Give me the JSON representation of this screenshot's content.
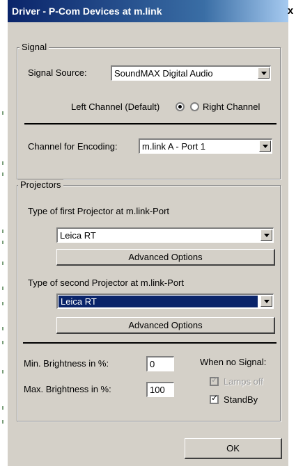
{
  "window": {
    "title": "Driver - P-Com Devices at m.link"
  },
  "signal": {
    "group_label": "Signal",
    "source_label": "Signal Source:",
    "source_value": "SoundMAX Digital Audio",
    "left_channel_label": "Left Channel (Default)",
    "right_channel_label": "Right Channel",
    "selected_channel": "left",
    "encoding_label": "Channel for Encoding:",
    "encoding_value": "m.link A - Port 1"
  },
  "projectors": {
    "group_label": "Projectors",
    "first_label": "Type of first Projector at m.link-Port",
    "first_value": "Leica RT",
    "first_advanced_label": "Advanced Options",
    "second_label": "Type of second Projector at m.link-Port",
    "second_value": "Leica RT",
    "second_advanced_label": "Advanced Options",
    "min_brightness_label": "Min. Brightness in %:",
    "min_brightness_value": "0",
    "max_brightness_label": "Max. Brightness in %:",
    "max_brightness_value": "100",
    "no_signal_label": "When no Signal:",
    "lamps_off_label": "Lamps off",
    "lamps_off_checked": true,
    "lamps_off_enabled": false,
    "standby_label": "StandBy",
    "standby_checked": true
  },
  "footer": {
    "ok_label": "OK"
  },
  "icons": {
    "close": "close-icon",
    "dropdown": "chevron-down-icon"
  },
  "colors": {
    "title_bar": "#0a246a",
    "dialog_bg": "#d4d0c8",
    "selection": "#0a246a"
  }
}
